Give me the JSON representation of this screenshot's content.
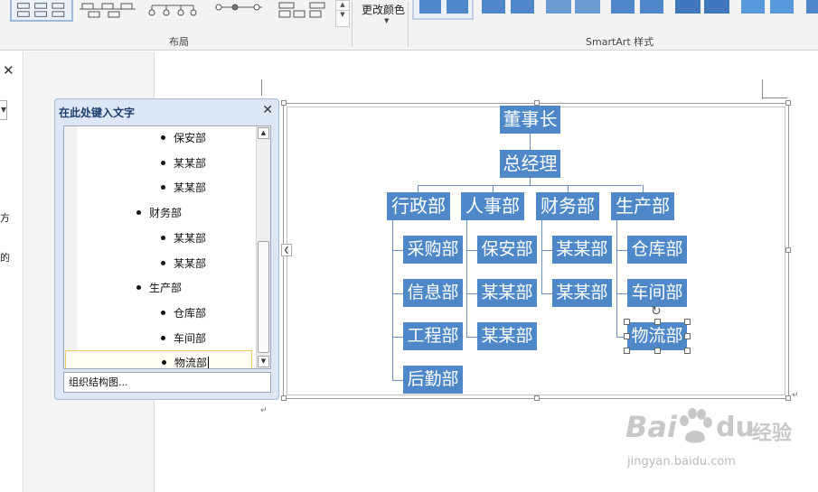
{
  "ribbon": {
    "layout_group_label": "布局",
    "change_colors_label": "更改颜色",
    "styles_group_label": "SmartArt 样式"
  },
  "left_fragments": {
    "line1": "方",
    "line2": "的"
  },
  "text_pane": {
    "title": "在此处键入文字",
    "items": [
      {
        "text": "保安部",
        "level": 2
      },
      {
        "text": "某某部",
        "level": 2
      },
      {
        "text": "某某部",
        "level": 2
      },
      {
        "text": "财务部",
        "level": 1
      },
      {
        "text": "某某部",
        "level": 2
      },
      {
        "text": "某某部",
        "level": 2
      },
      {
        "text": "生产部",
        "level": 1
      },
      {
        "text": "仓库部",
        "level": 2
      },
      {
        "text": "车间部",
        "level": 2
      },
      {
        "text": "物流部",
        "level": 2
      }
    ],
    "footer": "组织结构图..."
  },
  "org_chart": {
    "chairman": "董事长",
    "manager": "总经理",
    "departments": [
      {
        "name": "行政部",
        "children": [
          "采购部",
          "信息部",
          "工程部",
          "后勤部"
        ]
      },
      {
        "name": "人事部",
        "children": [
          "保安部",
          "某某部",
          "某某部"
        ]
      },
      {
        "name": "财务部",
        "children": [
          "某某部",
          "某某部"
        ]
      },
      {
        "name": "生产部",
        "children": [
          "仓库部",
          "车间部",
          "物流部"
        ]
      }
    ]
  },
  "colors": {
    "node_fill": "#4f88c9",
    "node_text": "#ffffff",
    "connector": "#6b8fbf"
  },
  "watermark": {
    "brand_bai": "Bai",
    "brand_du": "du",
    "brand_jingyan": "经验",
    "url": "jingyan.baidu.com"
  },
  "marks": {
    "para": "↵"
  }
}
